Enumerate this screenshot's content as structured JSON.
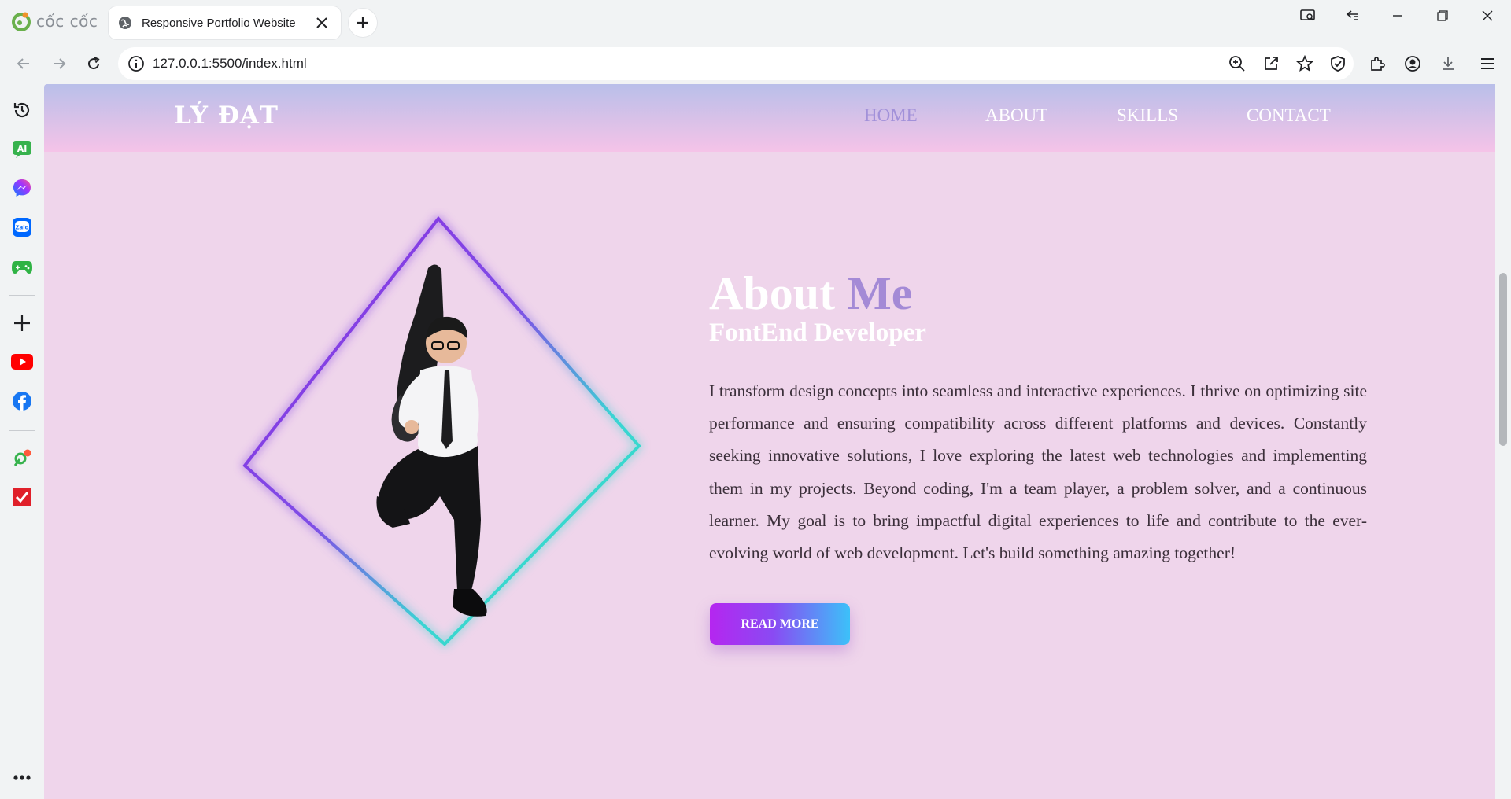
{
  "browser": {
    "brand": "cốc cốc",
    "tab": {
      "title": "Responsive Portfolio Website"
    },
    "address": {
      "url": "127.0.0.1:5500/index.html"
    }
  },
  "site": {
    "logo": "LÝ ĐẠT",
    "nav": [
      {
        "label": "HOME",
        "active": true
      },
      {
        "label": "ABOUT",
        "active": false
      },
      {
        "label": "SKILLS",
        "active": false
      },
      {
        "label": "CONTACT",
        "active": false
      }
    ],
    "about": {
      "title_main": "About",
      "title_accent": "Me",
      "subtitle": "FontEnd Developer",
      "paragraph": "I transform design concepts into seamless and interactive experiences. I thrive on optimizing site performance and ensuring compatibility across different platforms and devices. Constantly seeking innovative solutions, I love exploring the latest web technologies and implementing them in my projects. Beyond coding, I'm a team player, a problem solver, and a continuous learner. My goal is to bring impactful digital experiences to life and contribute to the ever-evolving world of web development. Let's build something amazing together!",
      "button": "READ MORE"
    }
  },
  "colors": {
    "page_bg": "#efd5eb",
    "header_top": "#b9bfe9",
    "header_bottom": "#f5c3e8",
    "accent": "#a48ad6",
    "button_start": "#b526f0",
    "button_end": "#3cc1f9"
  },
  "icons": {
    "sidebar": [
      "history-icon",
      "ai-icon",
      "messenger-icon",
      "zalo-icon",
      "game-icon",
      "add-icon",
      "youtube-icon",
      "facebook-icon",
      "maps-icon",
      "task-icon",
      "more-icon"
    ],
    "toolbar": [
      "zoom-icon",
      "share-icon",
      "bookmark-star-icon",
      "shield-icon",
      "extensions-icon",
      "profile-icon",
      "download-icon",
      "menu-icon"
    ]
  }
}
